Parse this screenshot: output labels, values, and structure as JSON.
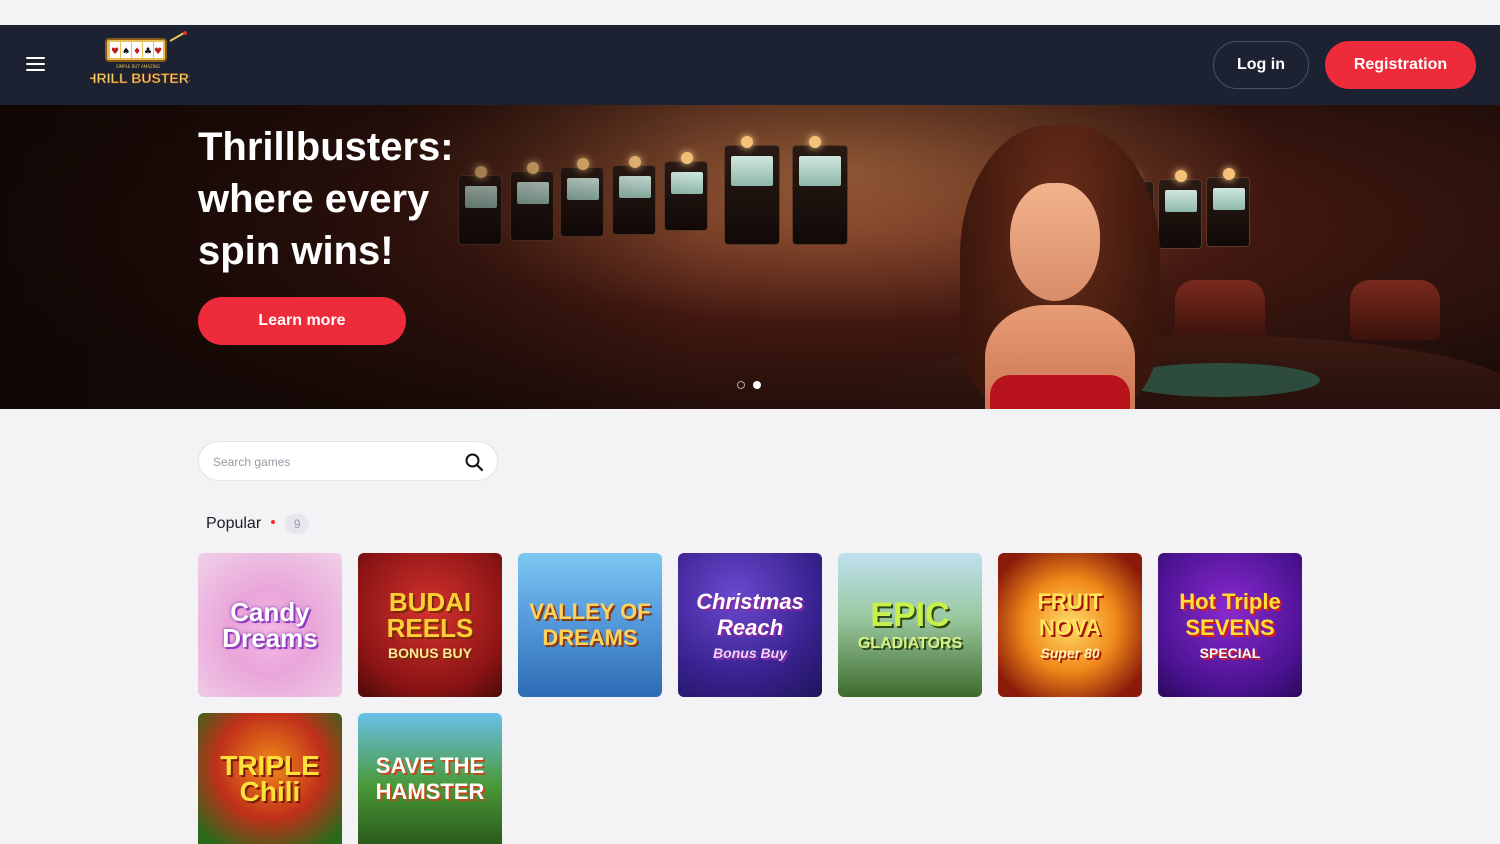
{
  "header": {
    "logo_top": "SIMPLE BUT AMAZING",
    "logo_name": "THRILL BUSTERS",
    "login_label": "Log in",
    "register_label": "Registration"
  },
  "hero": {
    "title_line1": "Thrillbusters:",
    "title_line2": "where every",
    "title_line3": "spin wins!",
    "cta_label": "Learn more",
    "slides": 2,
    "active_slide": 2
  },
  "search": {
    "placeholder": "Search games"
  },
  "popular": {
    "title": "Popular",
    "count": "9",
    "games": [
      {
        "title": "Candy Dreams",
        "sub": ""
      },
      {
        "title": "BUDAI REELS",
        "sub": "BONUS BUY"
      },
      {
        "title": "VALLEY OF DREAMS",
        "sub": ""
      },
      {
        "title": "Christmas Reach",
        "sub": "Bonus Buy"
      },
      {
        "title": "EPIC",
        "sub": "GLADIATORS"
      },
      {
        "title": "FRUIT NOVA",
        "sub": "Super 80"
      },
      {
        "title": "Hot Triple SEVENS",
        "sub": "SPECIAL"
      },
      {
        "title": "TRIPLE Chili",
        "sub": ""
      },
      {
        "title": "SAVE THE HAMSTER",
        "sub": ""
      }
    ]
  },
  "colors": {
    "header_bg": "#1c2232",
    "accent": "#ee2b3a",
    "page_bg": "#f3f3f5"
  }
}
